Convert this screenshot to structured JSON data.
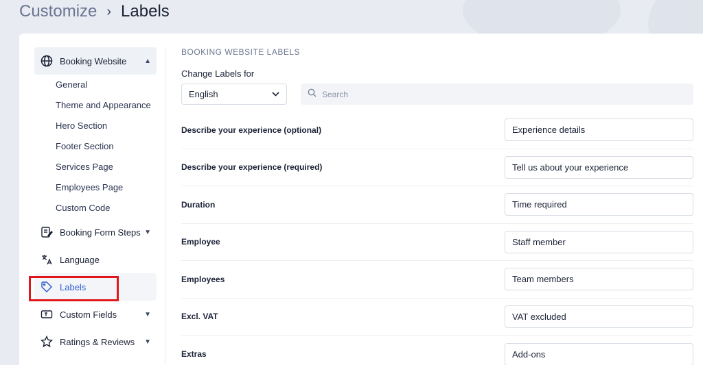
{
  "breadcrumb": {
    "parent": "Customize",
    "separator": "›",
    "current": "Labels"
  },
  "sidebar": {
    "booking_website": {
      "label": "Booking Website",
      "icon": "globe-icon",
      "expanded": true,
      "items": [
        "General",
        "Theme and Appearance",
        "Hero Section",
        "Footer Section",
        "Services Page",
        "Employees Page",
        "Custom Code"
      ]
    },
    "booking_form_steps": {
      "label": "Booking Form Steps",
      "icon": "form-edit-icon"
    },
    "language": {
      "label": "Language",
      "icon": "translate-icon"
    },
    "labels": {
      "label": "Labels",
      "icon": "tag-icon",
      "active": true
    },
    "custom_fields": {
      "label": "Custom Fields",
      "icon": "text-field-icon"
    },
    "ratings_reviews": {
      "label": "Ratings & Reviews",
      "icon": "star-icon"
    }
  },
  "main": {
    "section_title": "BOOKING WEBSITE LABELS",
    "change_labels_for": "Change Labels for",
    "language_select": "English",
    "search_placeholder": "Search",
    "rows": [
      {
        "label": "Describe your experience (optional)",
        "value": "Experience details"
      },
      {
        "label": "Describe your experience (required)",
        "value": "Tell us about your experience"
      },
      {
        "label": "Duration",
        "value": "Time required"
      },
      {
        "label": "Employee",
        "value": "Staff member"
      },
      {
        "label": "Employees",
        "value": "Team members"
      },
      {
        "label": "Excl. VAT",
        "value": "VAT excluded"
      },
      {
        "label": "Extras",
        "value": "Add-ons"
      }
    ]
  },
  "colors": {
    "accent": "#2f5fd0",
    "highlight_box": "#e0161b",
    "background": "#e8ebf2"
  }
}
